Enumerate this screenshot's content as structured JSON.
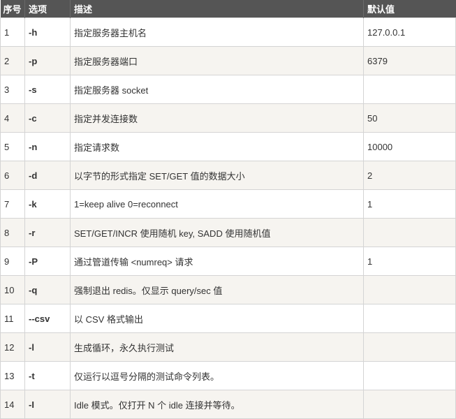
{
  "headers": [
    "序号",
    "选项",
    "描述",
    "默认值"
  ],
  "rows": [
    [
      "1",
      "-h",
      "指定服务器主机名",
      "127.0.0.1"
    ],
    [
      "2",
      "-p",
      "指定服务器端口",
      "6379"
    ],
    [
      "3",
      "-s",
      "指定服务器 socket",
      ""
    ],
    [
      "4",
      "-c",
      "指定并发连接数",
      "50"
    ],
    [
      "5",
      "-n",
      "指定请求数",
      "10000"
    ],
    [
      "6",
      "-d",
      "以字节的形式指定 SET/GET 值的数据大小",
      "2"
    ],
    [
      "7",
      "-k",
      "1=keep alive 0=reconnect",
      "1"
    ],
    [
      "8",
      "-r",
      "SET/GET/INCR 使用随机 key, SADD 使用随机值",
      ""
    ],
    [
      "9",
      "-P",
      "通过管道传输 <numreq> 请求",
      "1"
    ],
    [
      "10",
      "-q",
      "强制退出 redis。仅显示 query/sec 值",
      ""
    ],
    [
      "11",
      "--csv",
      "以 CSV 格式输出",
      ""
    ],
    [
      "12",
      "-l",
      "生成循环，永久执行测试",
      ""
    ],
    [
      "13",
      "-t",
      "仅运行以逗号分隔的测试命令列表。",
      ""
    ],
    [
      "14",
      "-I",
      "Idle 模式。仅打开 N 个 idle 连接并等待。",
      ""
    ]
  ]
}
